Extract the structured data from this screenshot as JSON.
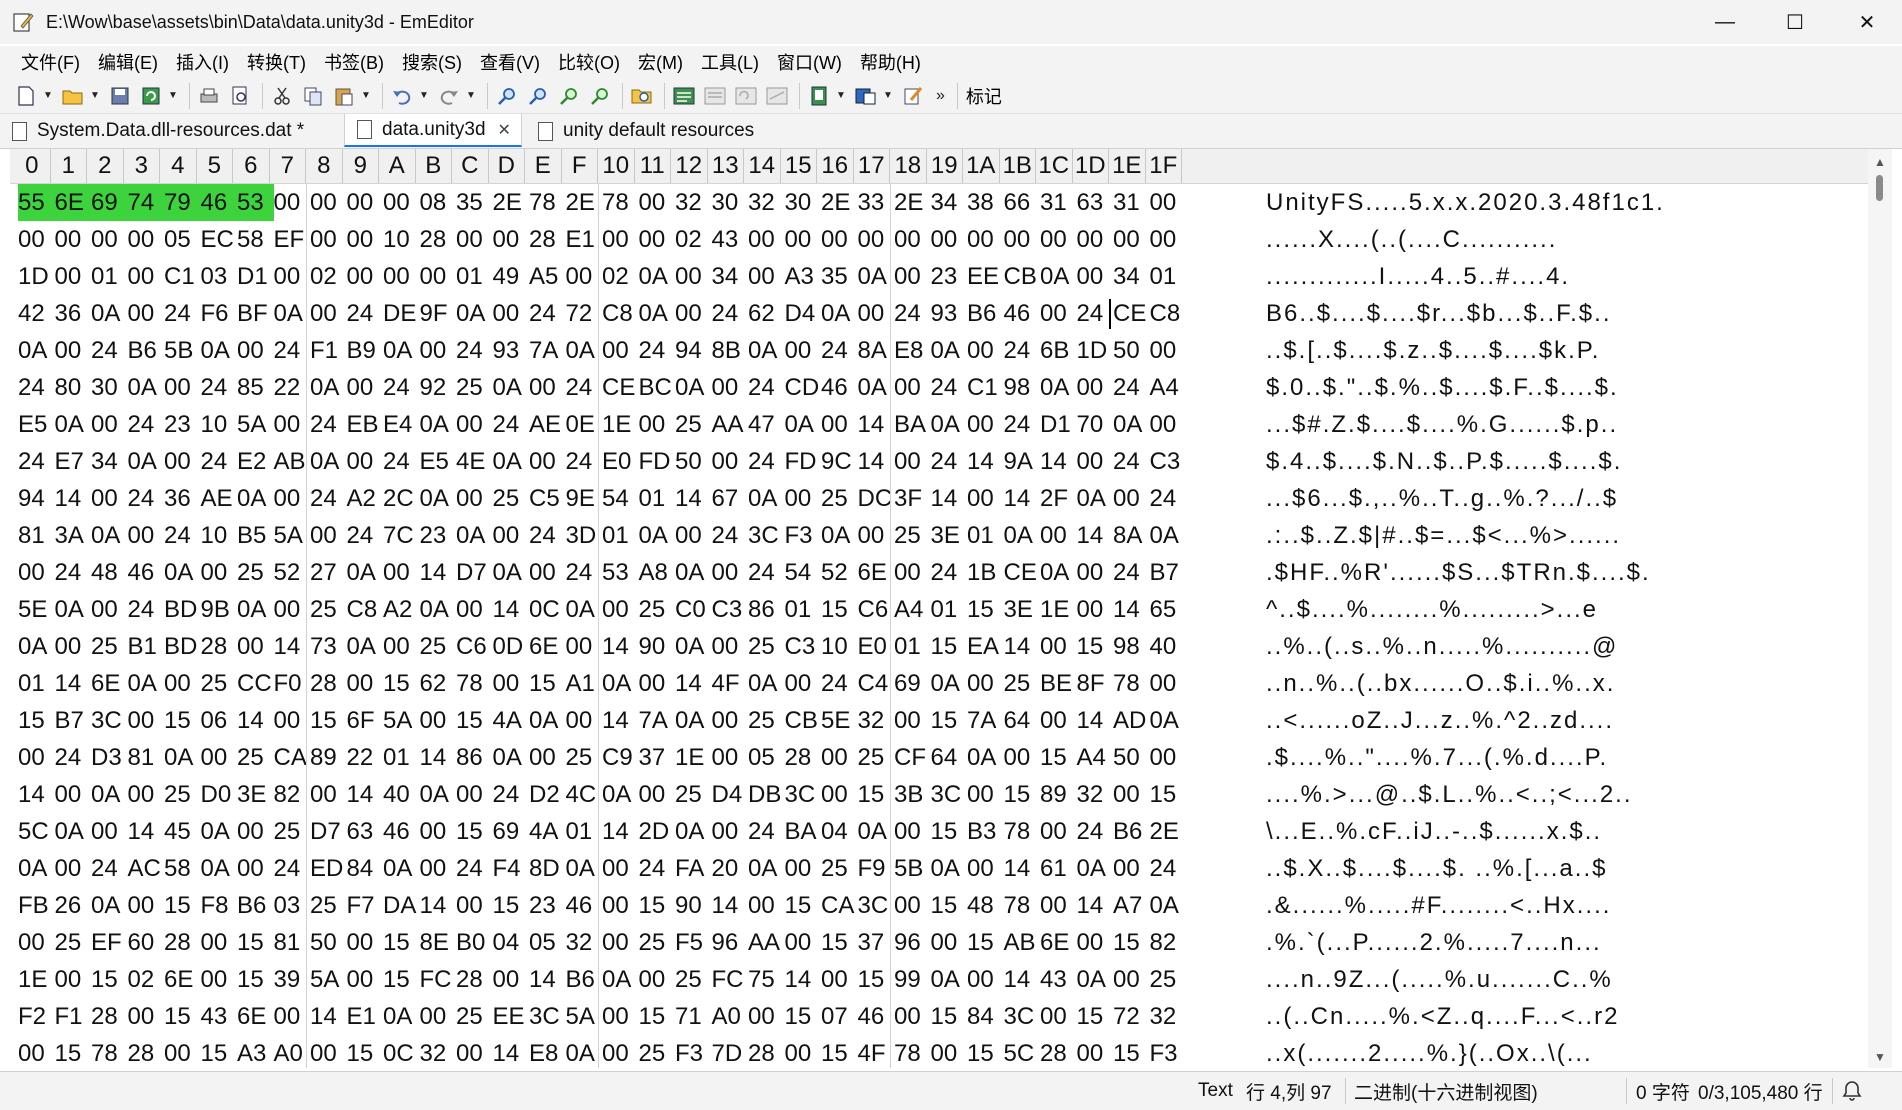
{
  "window": {
    "title": "E:\\Wow\\base\\assets\\bin\\Data\\data.unity3d - EmEditor",
    "minimize": "—",
    "maximize": "☐",
    "close": "✕"
  },
  "menu": [
    "文件(F)",
    "编辑(E)",
    "插入(I)",
    "转换(T)",
    "书签(B)",
    "搜索(S)",
    "查看(V)",
    "比较(O)",
    "宏(M)",
    "工具(L)",
    "窗口(W)",
    "帮助(H)"
  ],
  "toolbar": {
    "more": "»",
    "bookmark_label": "标记"
  },
  "tabs": [
    {
      "label": "System.Data.dll-resources.dat *",
      "active": false
    },
    {
      "label": "data.unity3d",
      "active": true
    },
    {
      "label": "unity default resources",
      "active": false
    }
  ],
  "ruler": [
    "0",
    "1",
    "2",
    "3",
    "4",
    "5",
    "6",
    "7",
    "8",
    "9",
    "A",
    "B",
    "C",
    "D",
    "E",
    "F",
    "10",
    "11",
    "12",
    "13",
    "14",
    "15",
    "16",
    "17",
    "18",
    "19",
    "1A",
    "1B",
    "1C",
    "1D",
    "1E",
    "1F"
  ],
  "hex_rows": [
    {
      "hex": [
        "55",
        "6E",
        "69",
        "74",
        "79",
        "46",
        "53",
        "00",
        "00",
        "00",
        "00",
        "08",
        "35",
        "2E",
        "78",
        "2E",
        "78",
        "00",
        "32",
        "30",
        "32",
        "30",
        "2E",
        "33",
        "2E",
        "34",
        "38",
        "66",
        "31",
        "63",
        "31",
        "00"
      ],
      "ascii": "UnityFS.....5.x.x.2020.3.48f1c1."
    },
    {
      "hex": [
        "00",
        "00",
        "00",
        "00",
        "05",
        "EC",
        "58",
        "EF",
        "00",
        "00",
        "10",
        "28",
        "00",
        "00",
        "28",
        "E1",
        "00",
        "00",
        "02",
        "43",
        "00",
        "00",
        "00",
        "00",
        "00",
        "00",
        "00",
        "00",
        "00",
        "00",
        "00",
        "00"
      ],
      "ascii": "......X....(..(....C..........."
    },
    {
      "hex": [
        "1D",
        "00",
        "01",
        "00",
        "C1",
        "03",
        "D1",
        "00",
        "02",
        "00",
        "00",
        "00",
        "01",
        "49",
        "A5",
        "00",
        "02",
        "0A",
        "00",
        "34",
        "00",
        "A3",
        "35",
        "0A",
        "00",
        "23",
        "EE",
        "CB",
        "0A",
        "00",
        "34",
        "01"
      ],
      "ascii": ".............I.....4..5..#....4."
    },
    {
      "hex": [
        "42",
        "36",
        "0A",
        "00",
        "24",
        "F6",
        "BF",
        "0A",
        "00",
        "24",
        "DE",
        "9F",
        "0A",
        "00",
        "24",
        "72",
        "C8",
        "0A",
        "00",
        "24",
        "62",
        "D4",
        "0A",
        "00",
        "24",
        "93",
        "B6",
        "46",
        "00",
        "24",
        "CE",
        "C8"
      ],
      "ascii": "B6..$....$....$r...$b...$..F.$.."
    },
    {
      "hex": [
        "0A",
        "00",
        "24",
        "B6",
        "5B",
        "0A",
        "00",
        "24",
        "F1",
        "B9",
        "0A",
        "00",
        "24",
        "93",
        "7A",
        "0A",
        "00",
        "24",
        "94",
        "8B",
        "0A",
        "00",
        "24",
        "8A",
        "E8",
        "0A",
        "00",
        "24",
        "6B",
        "1D",
        "50",
        "00"
      ],
      "ascii": "..$.[..$....$.z..$....$....$k.P."
    },
    {
      "hex": [
        "24",
        "80",
        "30",
        "0A",
        "00",
        "24",
        "85",
        "22",
        "0A",
        "00",
        "24",
        "92",
        "25",
        "0A",
        "00",
        "24",
        "CE",
        "BC",
        "0A",
        "00",
        "24",
        "CD",
        "46",
        "0A",
        "00",
        "24",
        "C1",
        "98",
        "0A",
        "00",
        "24",
        "A4"
      ],
      "ascii": "$.0..$.\"..$.%..$....$.F..$....$."
    },
    {
      "hex": [
        "E5",
        "0A",
        "00",
        "24",
        "23",
        "10",
        "5A",
        "00",
        "24",
        "EB",
        "E4",
        "0A",
        "00",
        "24",
        "AE",
        "0E",
        "1E",
        "00",
        "25",
        "AA",
        "47",
        "0A",
        "00",
        "14",
        "BA",
        "0A",
        "00",
        "24",
        "D1",
        "70",
        "0A",
        "00"
      ],
      "ascii": "...$#.Z.$....$....%.G......$.p.."
    },
    {
      "hex": [
        "24",
        "E7",
        "34",
        "0A",
        "00",
        "24",
        "E2",
        "AB",
        "0A",
        "00",
        "24",
        "E5",
        "4E",
        "0A",
        "00",
        "24",
        "E0",
        "FD",
        "50",
        "00",
        "24",
        "FD",
        "9C",
        "14",
        "00",
        "24",
        "14",
        "9A",
        "14",
        "00",
        "24",
        "C3"
      ],
      "ascii": "$.4..$....$.N..$..P.$.....$....$."
    },
    {
      "hex": [
        "94",
        "14",
        "00",
        "24",
        "36",
        "AE",
        "0A",
        "00",
        "24",
        "A2",
        "2C",
        "0A",
        "00",
        "25",
        "C5",
        "9E",
        "54",
        "01",
        "14",
        "67",
        "0A",
        "00",
        "25",
        "DC",
        "3F",
        "14",
        "00",
        "14",
        "2F",
        "0A",
        "00",
        "24"
      ],
      "ascii": "...$6...$.,..%..T..g..%.?.../..$"
    },
    {
      "hex": [
        "81",
        "3A",
        "0A",
        "00",
        "24",
        "10",
        "B5",
        "5A",
        "00",
        "24",
        "7C",
        "23",
        "0A",
        "00",
        "24",
        "3D",
        "01",
        "0A",
        "00",
        "24",
        "3C",
        "F3",
        "0A",
        "00",
        "25",
        "3E",
        "01",
        "0A",
        "00",
        "14",
        "8A",
        "0A"
      ],
      "ascii": ".:..$..Z.$|#..$=...$<...%>......"
    },
    {
      "hex": [
        "00",
        "24",
        "48",
        "46",
        "0A",
        "00",
        "25",
        "52",
        "27",
        "0A",
        "00",
        "14",
        "D7",
        "0A",
        "00",
        "24",
        "53",
        "A8",
        "0A",
        "00",
        "24",
        "54",
        "52",
        "6E",
        "00",
        "24",
        "1B",
        "CE",
        "0A",
        "00",
        "24",
        "B7"
      ],
      "ascii": ".$HF..%R'......$S...$TRn.$....$."
    },
    {
      "hex": [
        "5E",
        "0A",
        "00",
        "24",
        "BD",
        "9B",
        "0A",
        "00",
        "25",
        "C8",
        "A2",
        "0A",
        "00",
        "14",
        "0C",
        "0A",
        "00",
        "25",
        "C0",
        "C3",
        "86",
        "01",
        "15",
        "C6",
        "A4",
        "01",
        "15",
        "3E",
        "1E",
        "00",
        "14",
        "65"
      ],
      "ascii": "^..$....%........%.........>...e"
    },
    {
      "hex": [
        "0A",
        "00",
        "25",
        "B1",
        "BD",
        "28",
        "00",
        "14",
        "73",
        "0A",
        "00",
        "25",
        "C6",
        "0D",
        "6E",
        "00",
        "14",
        "90",
        "0A",
        "00",
        "25",
        "C3",
        "10",
        "E0",
        "01",
        "15",
        "EA",
        "14",
        "00",
        "15",
        "98",
        "40"
      ],
      "ascii": "..%..(..s..%..n.....%..........@"
    },
    {
      "hex": [
        "01",
        "14",
        "6E",
        "0A",
        "00",
        "25",
        "CC",
        "F0",
        "28",
        "00",
        "15",
        "62",
        "78",
        "00",
        "15",
        "A1",
        "0A",
        "00",
        "14",
        "4F",
        "0A",
        "00",
        "24",
        "C4",
        "69",
        "0A",
        "00",
        "25",
        "BE",
        "8F",
        "78",
        "00"
      ],
      "ascii": "..n..%..(..bx......O..$.i..%..x."
    },
    {
      "hex": [
        "15",
        "B7",
        "3C",
        "00",
        "15",
        "06",
        "14",
        "00",
        "15",
        "6F",
        "5A",
        "00",
        "15",
        "4A",
        "0A",
        "00",
        "14",
        "7A",
        "0A",
        "00",
        "25",
        "CB",
        "5E",
        "32",
        "00",
        "15",
        "7A",
        "64",
        "00",
        "14",
        "AD",
        "0A"
      ],
      "ascii": "..<......oZ..J...z..%.^2..zd...."
    },
    {
      "hex": [
        "00",
        "24",
        "D3",
        "81",
        "0A",
        "00",
        "25",
        "CA",
        "89",
        "22",
        "01",
        "14",
        "86",
        "0A",
        "00",
        "25",
        "C9",
        "37",
        "1E",
        "00",
        "05",
        "28",
        "00",
        "25",
        "CF",
        "64",
        "0A",
        "00",
        "15",
        "A4",
        "50",
        "00"
      ],
      "ascii": ".$....%..\"....%.7...(.%.d....P."
    },
    {
      "hex": [
        "14",
        "00",
        "0A",
        "00",
        "25",
        "D0",
        "3E",
        "82",
        "00",
        "14",
        "40",
        "0A",
        "00",
        "24",
        "D2",
        "4C",
        "0A",
        "00",
        "25",
        "D4",
        "DB",
        "3C",
        "00",
        "15",
        "3B",
        "3C",
        "00",
        "15",
        "89",
        "32",
        "00",
        "15"
      ],
      "ascii": "....%.>...@..$.L..%..<..;<...2.."
    },
    {
      "hex": [
        "5C",
        "0A",
        "00",
        "14",
        "45",
        "0A",
        "00",
        "25",
        "D7",
        "63",
        "46",
        "00",
        "15",
        "69",
        "4A",
        "01",
        "14",
        "2D",
        "0A",
        "00",
        "24",
        "BA",
        "04",
        "0A",
        "00",
        "15",
        "B3",
        "78",
        "00",
        "24",
        "B6",
        "2E"
      ],
      "ascii": "\\...E..%.cF..iJ..-..$......x.$.."
    },
    {
      "hex": [
        "0A",
        "00",
        "24",
        "AC",
        "58",
        "0A",
        "00",
        "24",
        "ED",
        "84",
        "0A",
        "00",
        "24",
        "F4",
        "8D",
        "0A",
        "00",
        "24",
        "FA",
        "20",
        "0A",
        "00",
        "25",
        "F9",
        "5B",
        "0A",
        "00",
        "14",
        "61",
        "0A",
        "00",
        "24"
      ],
      "ascii": "..$.X..$....$....$. ..%.[...a..$"
    },
    {
      "hex": [
        "FB",
        "26",
        "0A",
        "00",
        "15",
        "F8",
        "B6",
        "03",
        "25",
        "F7",
        "DA",
        "14",
        "00",
        "15",
        "23",
        "46",
        "00",
        "15",
        "90",
        "14",
        "00",
        "15",
        "CA",
        "3C",
        "00",
        "15",
        "48",
        "78",
        "00",
        "14",
        "A7",
        "0A"
      ],
      "ascii": ".&......%.....#F........<..Hx...."
    },
    {
      "hex": [
        "00",
        "25",
        "EF",
        "60",
        "28",
        "00",
        "15",
        "81",
        "50",
        "00",
        "15",
        "8E",
        "B0",
        "04",
        "05",
        "32",
        "00",
        "25",
        "F5",
        "96",
        "AA",
        "00",
        "15",
        "37",
        "96",
        "00",
        "15",
        "AB",
        "6E",
        "00",
        "15",
        "82"
      ],
      "ascii": ".%.`(...P......2.%.....7....n..."
    },
    {
      "hex": [
        "1E",
        "00",
        "15",
        "02",
        "6E",
        "00",
        "15",
        "39",
        "5A",
        "00",
        "15",
        "FC",
        "28",
        "00",
        "14",
        "B6",
        "0A",
        "00",
        "25",
        "FC",
        "75",
        "14",
        "00",
        "15",
        "99",
        "0A",
        "00",
        "14",
        "43",
        "0A",
        "00",
        "25"
      ],
      "ascii": "....n..9Z...(.....%.u.......C..%"
    },
    {
      "hex": [
        "F2",
        "F1",
        "28",
        "00",
        "15",
        "43",
        "6E",
        "00",
        "14",
        "E1",
        "0A",
        "00",
        "25",
        "EE",
        "3C",
        "5A",
        "00",
        "15",
        "71",
        "A0",
        "00",
        "15",
        "07",
        "46",
        "00",
        "15",
        "84",
        "3C",
        "00",
        "15",
        "72",
        "32"
      ],
      "ascii": "..(..Cn.....%.<Z..q....F...<..r2"
    },
    {
      "hex": [
        "00",
        "15",
        "78",
        "28",
        "00",
        "15",
        "A3",
        "A0",
        "00",
        "15",
        "0C",
        "32",
        "00",
        "14",
        "E8",
        "0A",
        "00",
        "25",
        "F3",
        "7D",
        "28",
        "00",
        "15",
        "4F",
        "78",
        "00",
        "15",
        "5C",
        "28",
        "00",
        "15",
        "F3"
      ],
      "ascii": "..x(.......2.....%.}(..Ox..\\(..."
    }
  ],
  "status": {
    "mode": "Text",
    "position": "行 4,列 97",
    "view": "二进制(十六进制视图)",
    "chars": "0 字符",
    "lines": "0/3,105,480 行"
  },
  "colors": {
    "selection": "#3dd33d",
    "chrome": "#f3f3f3",
    "tab_accent": "#1a73e8"
  }
}
